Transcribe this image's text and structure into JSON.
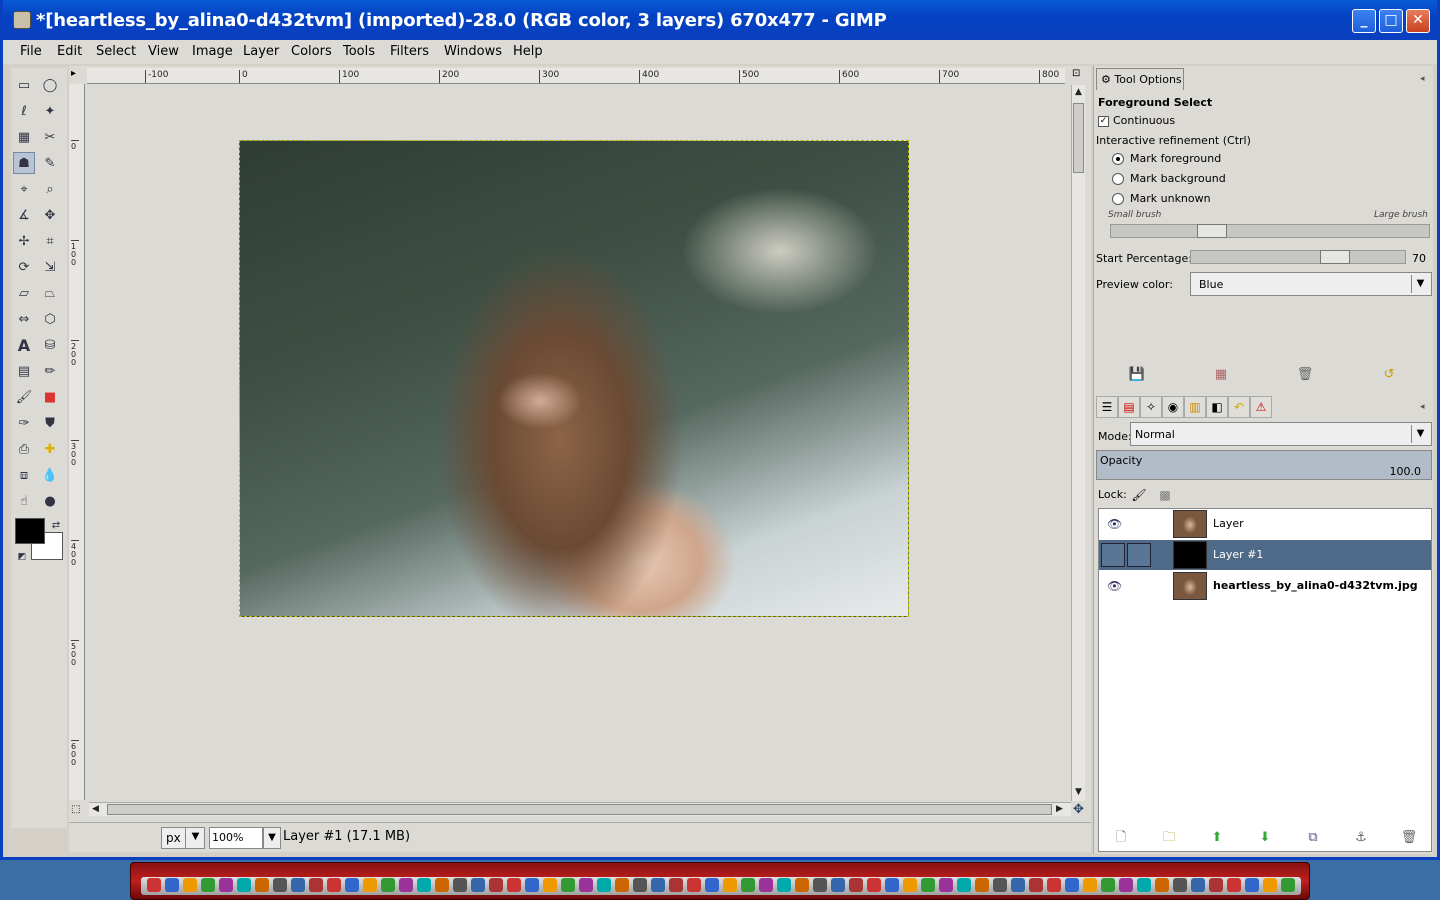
{
  "window": {
    "title": "*[heartless_by_alina0-d432tvm] (imported)-28.0 (RGB color, 3 layers) 670x477 - GIMP",
    "minimize_glyph": "_",
    "maximize_glyph": "□",
    "close_glyph": "✕"
  },
  "menu": [
    "File",
    "Edit",
    "Select",
    "View",
    "Image",
    "Layer",
    "Colors",
    "Tools",
    "Filters",
    "Windows",
    "Help"
  ],
  "ruler": {
    "h_ticks": [
      "-100",
      "0",
      "100",
      "200",
      "300",
      "400",
      "500",
      "600",
      "700",
      "800"
    ],
    "v_ticks": [
      "0",
      "100",
      "200",
      "300",
      "400",
      "500",
      "600"
    ]
  },
  "statusbar": {
    "unit": "px",
    "zoom": "100",
    "zoom_suffix": "%",
    "message": "Layer #1 (17.1 MB)"
  },
  "tool_options": {
    "tab_label": "Tool Options",
    "title": "Foreground Select",
    "continuous_label": "Continuous",
    "continuous_checked": true,
    "refinement_label": "Interactive refinement  (Ctrl)",
    "radios": [
      {
        "label": "Mark foreground",
        "checked": true
      },
      {
        "label": "Mark background",
        "checked": false
      },
      {
        "label": "Mark unknown",
        "checked": false
      }
    ],
    "small_brush": "Small brush",
    "large_brush": "Large brush",
    "start_percentage_label": "Start Percentage:",
    "start_percentage_value": "70",
    "start_percentage": 70,
    "preview_color_label": "Preview color:",
    "preview_color_value": "Blue"
  },
  "layers": {
    "mode_label": "Mode:",
    "mode_value": "Normal",
    "opacity_label": "Opacity",
    "opacity_value": "100.0",
    "lock_label": "Lock:",
    "items": [
      {
        "name": "Layer",
        "visible": true,
        "selected": false,
        "thumb": "photo"
      },
      {
        "name": "Layer #1",
        "visible": false,
        "selected": true,
        "thumb": "black"
      },
      {
        "name": "heartless_by_alina0-d432tvm.jpg",
        "visible": true,
        "selected": false,
        "thumb": "photo"
      }
    ]
  },
  "colors": {
    "titlebar": "#0a3fbf",
    "selection": "#4e6a88",
    "taskbar": "#c02020"
  }
}
